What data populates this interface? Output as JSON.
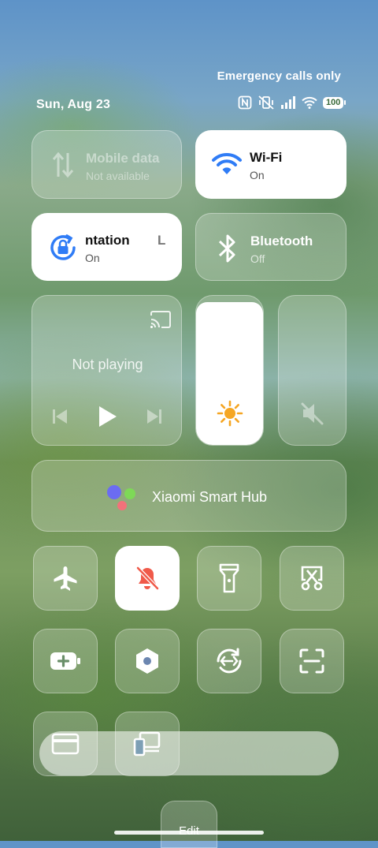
{
  "status": {
    "carrier": "Emergency calls only",
    "date": "Sun, Aug 23",
    "battery": "100"
  },
  "tiles": {
    "mobile_data": {
      "title": "Mobile data",
      "subtitle": "Not available"
    },
    "wifi": {
      "title": "Wi-Fi",
      "subtitle": "On"
    },
    "rotation": {
      "title": "ntation",
      "subtitle": "On",
      "trail": "L"
    },
    "bluetooth": {
      "title": "Bluetooth",
      "subtitle": "Off"
    }
  },
  "media": {
    "status": "Not playing"
  },
  "smart_hub": {
    "label": "Xiaomi Smart Hub"
  },
  "edit": {
    "label": "Edit"
  },
  "colors": {
    "accent_blue": "#2f7cf6",
    "mute_red": "#f05a4a",
    "brightness_yellow": "#f5a623"
  }
}
